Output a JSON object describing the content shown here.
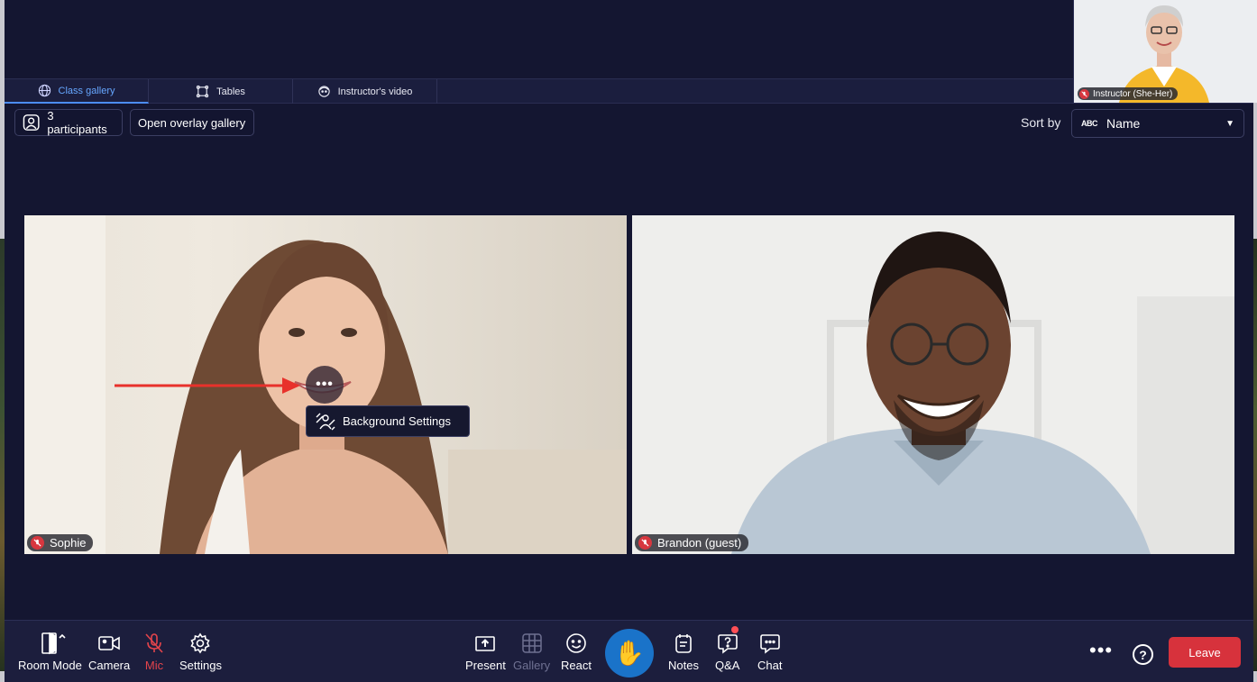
{
  "tabs": [
    {
      "label": "Class gallery",
      "icon": "globe-icon",
      "active": true
    },
    {
      "label": "Tables",
      "icon": "tables-icon",
      "active": false
    },
    {
      "label": "Instructor's video",
      "icon": "instructor-icon",
      "active": false
    }
  ],
  "selfview": {
    "name": "Instructor (She-Her)",
    "muted": true
  },
  "toolbar_top": {
    "participants_label": "3 participants",
    "overlay_label": "Open overlay gallery",
    "sort_by_label": "Sort by",
    "sort_value": "Name",
    "sort_icon_text": "ABC"
  },
  "tiles": [
    {
      "name": "Sophie",
      "muted": true
    },
    {
      "name": "Brandon (guest)",
      "muted": true
    }
  ],
  "tooltip": {
    "label": "Background Settings"
  },
  "more_button": {
    "label": "•••"
  },
  "bottom_bar": {
    "room_mode": "Room Mode",
    "camera": "Camera",
    "mic": "Mic",
    "settings": "Settings",
    "present": "Present",
    "gallery": "Gallery",
    "react": "React",
    "raise_hand": "✋",
    "notes": "Notes",
    "qa": "Q&A",
    "chat": "Chat",
    "more": "•••",
    "help": "?",
    "leave": "Leave"
  },
  "colors": {
    "background": "#141631",
    "accent": "#4c8df6",
    "leave": "#d7323c",
    "mic_off": "#e4444b",
    "raise_hand": "#1a73c9"
  }
}
